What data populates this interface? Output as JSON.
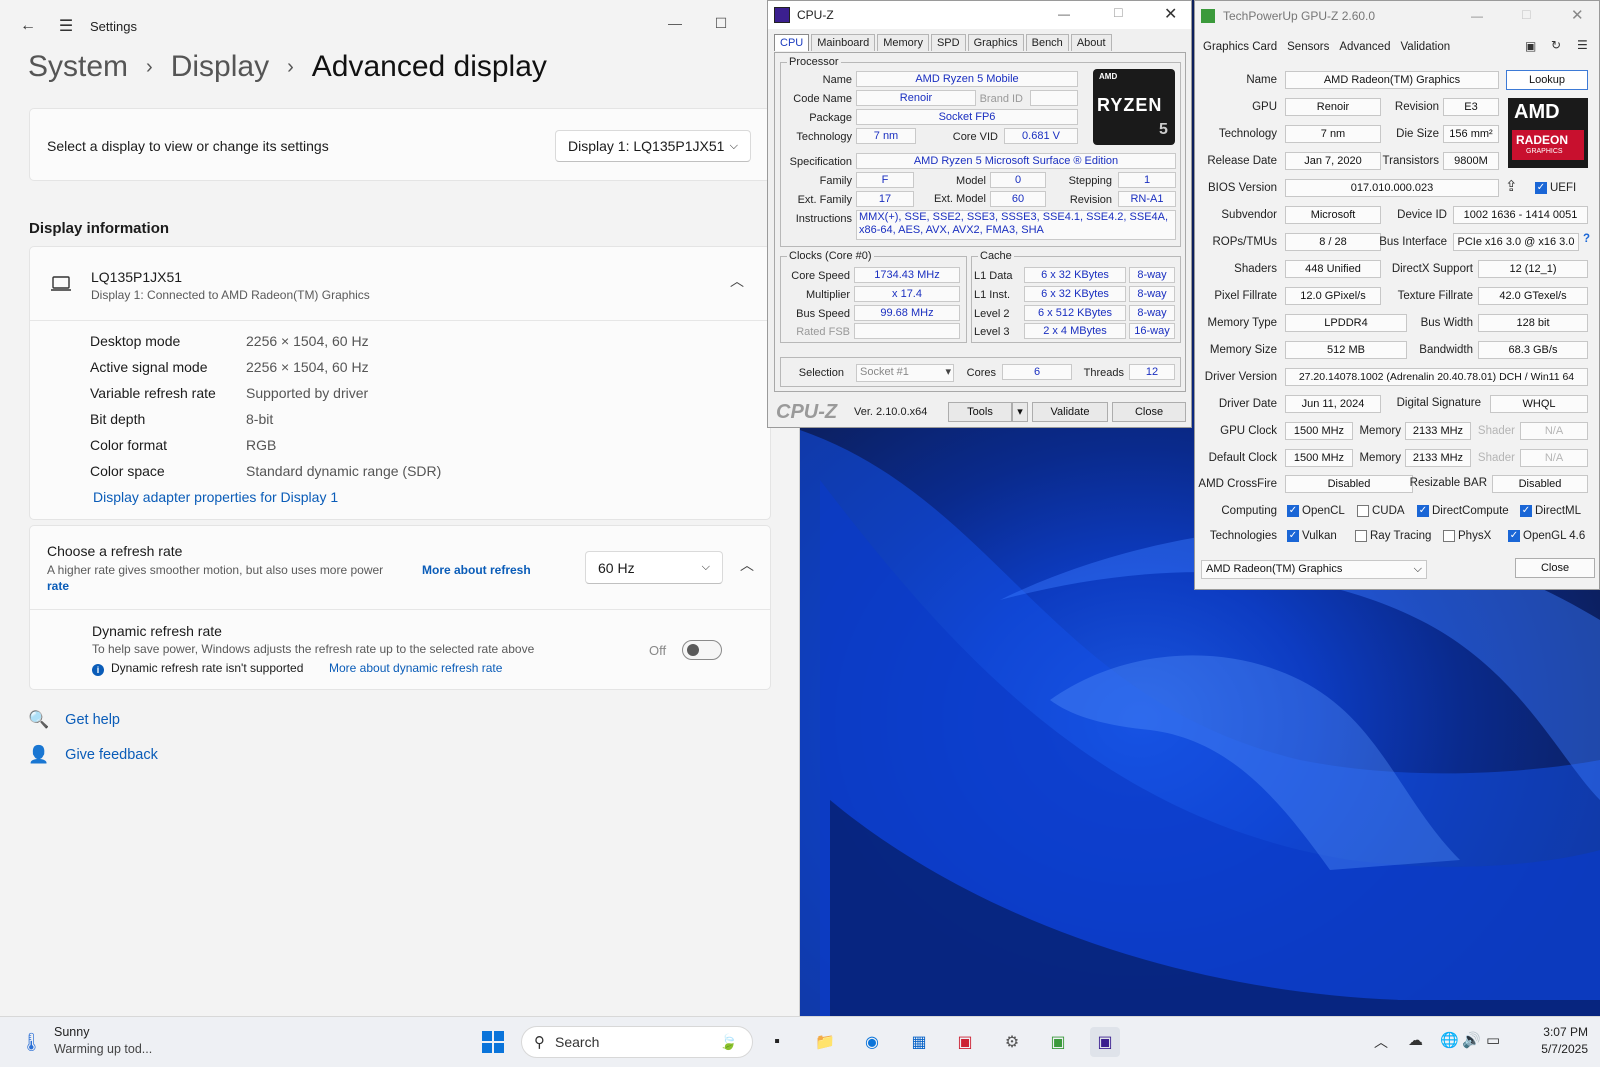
{
  "settings": {
    "title": "Settings",
    "breadcrumb": [
      "System",
      "Display",
      "Advanced display"
    ],
    "select_display_label": "Select a display to view or change its settings",
    "display_dropdown": "Display 1: LQ135P1JX51",
    "display_info_heading": "Display information",
    "monitor_name": "LQ135P1JX51",
    "monitor_sub": "Display 1: Connected to AMD Radeon(TM) Graphics",
    "info_rows": [
      {
        "k": "Desktop mode",
        "v": "2256 × 1504, 60 Hz"
      },
      {
        "k": "Active signal mode",
        "v": "2256 × 1504, 60 Hz"
      },
      {
        "k": "Variable refresh rate",
        "v": "Supported by driver"
      },
      {
        "k": "Bit depth",
        "v": "8-bit"
      },
      {
        "k": "Color format",
        "v": "RGB"
      },
      {
        "k": "Color space",
        "v": "Standard dynamic range (SDR)"
      }
    ],
    "adapter_link": "Display adapter properties for Display 1",
    "refresh_title": "Choose a refresh rate",
    "refresh_desc": "A higher rate gives smoother motion, but also uses more power",
    "refresh_link_a": "More about refresh",
    "refresh_link_b": "rate",
    "refresh_value": "60 Hz",
    "dyn_title": "Dynamic refresh rate",
    "dyn_desc": "To help save power, Windows adjusts the refresh rate up to the selected rate above",
    "dyn_state": "Off",
    "dyn_note": "Dynamic refresh rate isn't supported",
    "dyn_link": "More about dynamic refresh rate",
    "get_help": "Get help",
    "give_feedback": "Give feedback"
  },
  "cpuz": {
    "title": "CPU-Z",
    "tabs": [
      "CPU",
      "Mainboard",
      "Memory",
      "SPD",
      "Graphics",
      "Bench",
      "About"
    ],
    "processor_legend": "Processor",
    "name_l": "Name",
    "name": "AMD Ryzen 5 Mobile",
    "codename_l": "Code Name",
    "codename": "Renoir",
    "brandid_l": "Brand ID",
    "package_l": "Package",
    "package": "Socket FP6",
    "tech_l": "Technology",
    "tech": "7 nm",
    "corevid_l": "Core VID",
    "corevid": "0.681 V",
    "spec_l": "Specification",
    "spec": "AMD Ryzen 5 Microsoft Surface ® Edition",
    "family_l": "Family",
    "family": "F",
    "model_l": "Model",
    "model": "0",
    "stepping_l": "Stepping",
    "stepping": "1",
    "extfam_l": "Ext. Family",
    "extfam": "17",
    "extmodel_l": "Ext. Model",
    "extmodel": "60",
    "revision_l": "Revision",
    "revision": "RN-A1",
    "instr_l": "Instructions",
    "instr1": "MMX(+), SSE, SSE2, SSE3, SSSE3, SSE4.1, SSE4.2, SSE4A,",
    "instr2": "x86-64, AES, AVX, AVX2, FMA3, SHA",
    "logo_brand": "AMD",
    "logo_text": "RYZEN",
    "logo_num": "5",
    "clocks_legend": "Clocks (Core #0)",
    "corespeed_l": "Core Speed",
    "corespeed": "1734.43 MHz",
    "mult_l": "Multiplier",
    "mult": "x 17.4",
    "bus_l": "Bus Speed",
    "bus": "99.68 MHz",
    "fsb_l": "Rated FSB",
    "cache_legend": "Cache",
    "cache": [
      {
        "l": "L1 Data",
        "v": "6 x 32 KBytes",
        "w": "8-way"
      },
      {
        "l": "L1 Inst.",
        "v": "6 x 32 KBytes",
        "w": "8-way"
      },
      {
        "l": "Level 2",
        "v": "6 x 512 KBytes",
        "w": "8-way"
      },
      {
        "l": "Level 3",
        "v": "2 x 4 MBytes",
        "w": "16-way"
      }
    ],
    "selection_l": "Selection",
    "selection": "Socket #1",
    "cores_l": "Cores",
    "cores": "6",
    "threads_l": "Threads",
    "threads": "12",
    "brand": "CPU-Z",
    "version": "Ver. 2.10.0.x64",
    "tools": "Tools",
    "validate": "Validate",
    "close": "Close"
  },
  "gpuz": {
    "title": "TechPowerUp GPU-Z 2.60.0",
    "tabs": [
      "Graphics Card",
      "Sensors",
      "Advanced",
      "Validation"
    ],
    "name_l": "Name",
    "name": "AMD Radeon(TM) Graphics",
    "lookup": "Lookup",
    "gpu_l": "GPU",
    "gpu": "Renoir",
    "rev_l": "Revision",
    "rev": "E3",
    "tech_l": "Technology",
    "tech": "7 nm",
    "die_l": "Die Size",
    "die": "156 mm²",
    "rel_l": "Release Date",
    "rel": "Jan 7, 2020",
    "trans_l": "Transistors",
    "trans": "9800M",
    "bios_l": "BIOS Version",
    "bios": "017.010.000.023",
    "uefi": "UEFI",
    "subv_l": "Subvendor",
    "subv": "Microsoft",
    "devid_l": "Device ID",
    "devid": "1002 1636 - 1414 0051",
    "rops_l": "ROPs/TMUs",
    "rops": "8 / 28",
    "busi_l": "Bus Interface",
    "busi": "PCIe x16 3.0 @ x16 3.0",
    "shaders_l": "Shaders",
    "shaders": "448 Unified",
    "dx_l": "DirectX Support",
    "dx": "12 (12_1)",
    "pix_l": "Pixel Fillrate",
    "pix": "12.0 GPixel/s",
    "tex_l": "Texture Fillrate",
    "tex": "42.0 GTexel/s",
    "memt_l": "Memory Type",
    "memt": "LPDDR4",
    "busw_l": "Bus Width",
    "busw": "128 bit",
    "mems_l": "Memory Size",
    "mems": "512 MB",
    "bw_l": "Bandwidth",
    "bw": "68.3 GB/s",
    "drv_l": "Driver Version",
    "drv": "27.20.14078.1002 (Adrenalin 20.40.78.01) DCH / Win11 64",
    "drvd_l": "Driver Date",
    "drvd": "Jun 11, 2024",
    "sig_l": "Digital Signature",
    "sig": "WHQL",
    "gclk_l": "GPU Clock",
    "gclk": "1500 MHz",
    "mem_l": "Memory",
    "gmem": "2133 MHz",
    "shader_l": "Shader",
    "na": "N/A",
    "dclk_l": "Default Clock",
    "dclk": "1500 MHz",
    "dmem": "2133 MHz",
    "cf_l": "AMD CrossFire",
    "cf": "Disabled",
    "rbar_l": "Resizable BAR",
    "rbar": "Disabled",
    "comp_l": "Computing",
    "tech2_l": "Technologies",
    "opencl": "OpenCL",
    "cuda": "CUDA",
    "dcompute": "DirectCompute",
    "directml": "DirectML",
    "vulkan": "Vulkan",
    "rt": "Ray Tracing",
    "physx": "PhysX",
    "opengl": "OpenGL 4.6",
    "logo_brand": "AMD",
    "logo_line1": "RADEON",
    "logo_line2": "GRAPHICS",
    "sel": "AMD Radeon(TM) Graphics",
    "close": "Close"
  },
  "taskbar": {
    "weather1": "Sunny",
    "weather2": "Warming up tod...",
    "search": "Search",
    "time": "3:07 PM",
    "date": "5/7/2025"
  }
}
